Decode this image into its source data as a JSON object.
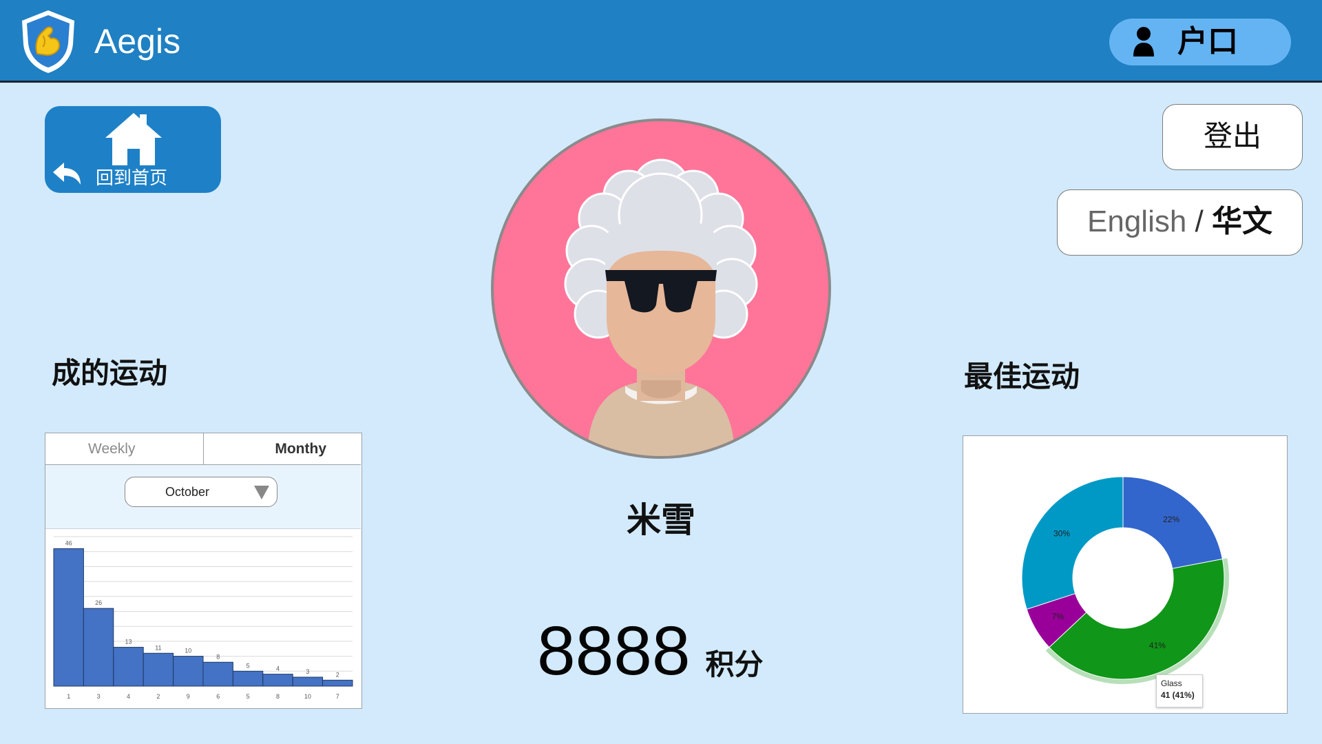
{
  "header": {
    "brand": "Aegis",
    "account_label": "户口",
    "logo_icon": "muscle-shield-icon",
    "account_icon": "person-icon"
  },
  "nav": {
    "home_label": "回到首页",
    "logout_label": "登出",
    "language": {
      "english": "English",
      "separator": " / ",
      "chinese": "华文"
    }
  },
  "profile": {
    "name": "米雪",
    "points_value": "8888",
    "points_unit": "积分"
  },
  "left_section": {
    "title": "成的运动",
    "tabs": [
      "Weekly",
      "Monthy"
    ],
    "active_tab": "Monthy",
    "selected_month": "October"
  },
  "right_section": {
    "title": "最佳运动",
    "tooltip": {
      "label": "Glass",
      "value": "41 (41%)"
    }
  },
  "colors": {
    "header": "#1f80c3",
    "background": "#d2eafc",
    "bar": "#4472c4",
    "slice_blue": "#3366cc",
    "slice_green": "#109618",
    "slice_purple": "#990099",
    "slice_teal": "#0099c6"
  },
  "chart_data": [
    {
      "type": "bar",
      "categories": [
        "1",
        "3",
        "4",
        "2",
        "9",
        "6",
        "5",
        "8",
        "10",
        "7"
      ],
      "values": [
        46,
        26,
        13,
        11,
        10,
        8,
        5,
        4,
        3,
        2
      ],
      "ylim": [
        0,
        50
      ]
    },
    {
      "type": "pie",
      "donut": true,
      "slices": [
        {
          "percent": 22,
          "color": "#3366cc"
        },
        {
          "percent": 41,
          "color": "#109618",
          "label": "Glass",
          "value": 41
        },
        {
          "percent": 7,
          "color": "#990099"
        },
        {
          "percent": 30,
          "color": "#0099c6"
        }
      ]
    }
  ]
}
